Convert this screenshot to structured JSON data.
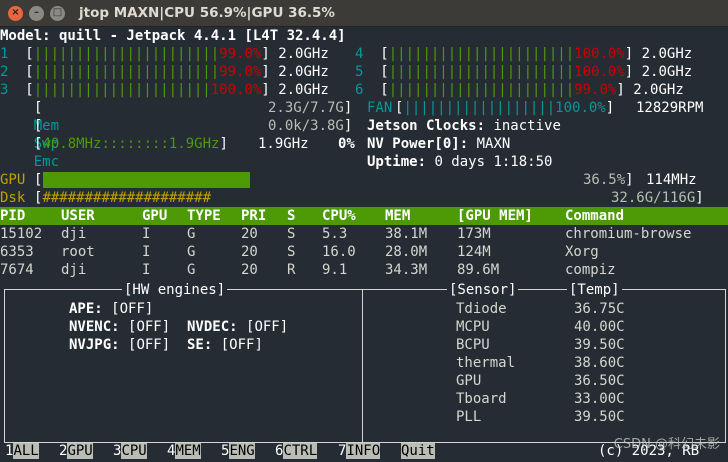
{
  "window": {
    "title": "jtop MAXN|CPU 56.9%|GPU 36.5%",
    "close_glyph": "×",
    "min_glyph": "–",
    "max_glyph": "□"
  },
  "header": {
    "model_line": "Model: quill - Jetpack 4.4.1 [L4T 32.4.4]"
  },
  "cpus": [
    {
      "id": "1",
      "bars": "||||||||||||||||||||||",
      "pct": "99.0%",
      "freq": "2.0GHz"
    },
    {
      "id": "2",
      "bars": "||||||||||||||||||||||",
      "pct": "99.0%",
      "freq": "2.0GHz"
    },
    {
      "id": "3",
      "bars": "|||||||||||||||||||||",
      "pct": "100.0%",
      "freq": "2.0GHz"
    },
    {
      "id": "4",
      "bars": "||||||||||||||||||||||",
      "pct": "100.0%",
      "freq": "2.0GHz"
    },
    {
      "id": "5",
      "bars": "||||||||||||||||||||||",
      "pct": "100.0%",
      "freq": "2.0GHz"
    },
    {
      "id": "6",
      "bars": "||||||||||||||||||||||",
      "pct": "99.0%",
      "freq": "2.0GHz"
    }
  ],
  "mem": {
    "label": "Mem",
    "value": "2.3G/7.7G"
  },
  "swp": {
    "label": "Swp",
    "value": "0.0k/3.8G"
  },
  "emc": {
    "label": "Emc",
    "range": "40.8MHz::::::::1.9GHz",
    "freq": "1.9GHz",
    "pct": "0%"
  },
  "fan": {
    "label": "FAN",
    "bars": "||||||||||||||||||",
    "pct": "100.0%",
    "rpm": "12829RPM"
  },
  "jetson_clocks": {
    "label": "Jetson Clocks:",
    "value": "inactive"
  },
  "nv_power": {
    "label": "NV Power[0]:",
    "value": "MAXN"
  },
  "uptime": {
    "label": "Uptime:",
    "value": "0 days 1:18:50"
  },
  "gpu": {
    "label": "GPU",
    "pct": "36.5%",
    "freq": "114MHz",
    "level": 0.365
  },
  "dsk": {
    "label": "Dsk",
    "bars": "####################",
    "value": "32.6G/116G"
  },
  "proc_headers": [
    "PID",
    "USER",
    "GPU",
    "TYPE",
    "PRI",
    "S",
    "CPU%",
    "MEM",
    "[GPU MEM]",
    "Command"
  ],
  "processes": [
    [
      "15102",
      "dji",
      "I",
      "G",
      "20",
      "S",
      "5.3",
      "38.1M",
      "173M",
      "chromium-browse"
    ],
    [
      "6353",
      "root",
      "I",
      "G",
      "20",
      "S",
      "16.0",
      "28.0M",
      "124M",
      "Xorg"
    ],
    [
      "7674",
      "dji",
      "I",
      "G",
      "20",
      "R",
      "9.1",
      "34.3M",
      "89.6M",
      "compiz"
    ]
  ],
  "hw_engines": {
    "title": "[HW engines]",
    "ape_label": "APE:",
    "ape_value": "[OFF]",
    "nvenc_label": "NVENC:",
    "nvenc_value": "[OFF]",
    "nvdec_label": "NVDEC:",
    "nvdec_value": "[OFF]",
    "nvjpg_label": "NVJPG:",
    "nvjpg_value": "[OFF]",
    "se_label": "SE:",
    "se_value": "[OFF]"
  },
  "sensors": {
    "title_sensor": "[Sensor]",
    "title_temp": "[Temp]",
    "rows": [
      {
        "name": "Tdiode",
        "temp": "36.75C"
      },
      {
        "name": "MCPU",
        "temp": "40.00C"
      },
      {
        "name": "BCPU",
        "temp": "39.50C"
      },
      {
        "name": "thermal",
        "temp": "38.60C"
      },
      {
        "name": "GPU",
        "temp": "36.50C"
      },
      {
        "name": "Tboard",
        "temp": "33.00C"
      },
      {
        "name": "PLL",
        "temp": "39.50C"
      }
    ]
  },
  "bottom_tabs": [
    {
      "num": "1",
      "label": "ALL"
    },
    {
      "num": "2",
      "label": "GPU"
    },
    {
      "num": "3",
      "label": "CPU"
    },
    {
      "num": "4",
      "label": "MEM"
    },
    {
      "num": "5",
      "label": "ENG"
    },
    {
      "num": "6",
      "label": "CTRL"
    },
    {
      "num": "7",
      "label": "INFO"
    },
    {
      "num": "",
      "label": "Quit"
    }
  ],
  "copyright": "(c) 2023, RB",
  "watermark": "CSDN @科幻未影",
  "colors": {
    "accent_green": "#4e9a06",
    "cpu_pct_red": "#cc0000",
    "cyan": "#06989a",
    "terminal_bg": "#252c33"
  }
}
